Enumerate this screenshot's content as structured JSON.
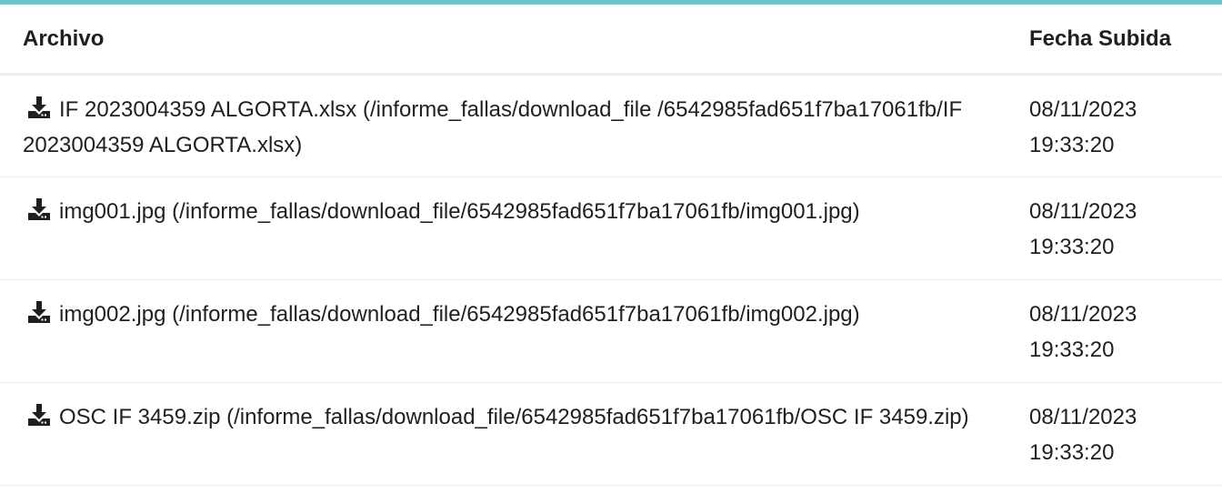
{
  "table": {
    "headers": {
      "file": "Archivo",
      "date": "Fecha Subida"
    },
    "rows": [
      {
        "file_text": "IF 2023004359 ALGORTA.xlsx (/informe_fallas/download_file /6542985fad651f7ba17061fb/IF 2023004359 ALGORTA.xlsx)",
        "date": "08/11/2023",
        "time": "19:33:20",
        "icon": "download-icon"
      },
      {
        "file_text": "img001.jpg (/informe_fallas/download_file/6542985fad651f7ba17061fb/img001.jpg)",
        "date": "08/11/2023",
        "time": "19:33:20",
        "icon": "download-icon"
      },
      {
        "file_text": "img002.jpg (/informe_fallas/download_file/6542985fad651f7ba17061fb/img002.jpg)",
        "date": "08/11/2023",
        "time": "19:33:20",
        "icon": "download-icon"
      },
      {
        "file_text": "OSC IF 3459.zip (/informe_fallas/download_file/6542985fad651f7ba17061fb/OSC IF 3459.zip)",
        "date": "08/11/2023",
        "time": "19:33:20",
        "icon": "download-icon"
      }
    ]
  },
  "colors": {
    "accent_border": "#6cc3cc",
    "text": "#1f1f1f",
    "row_divider": "#ececec"
  }
}
